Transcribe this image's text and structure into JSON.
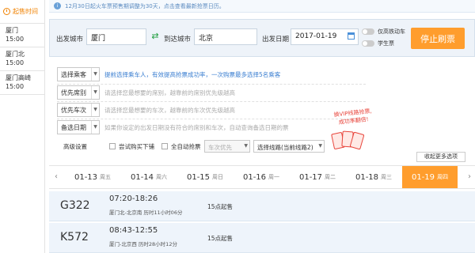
{
  "sidebar": {
    "header": "起售时间",
    "items": [
      {
        "station": "厦门",
        "time": "15:00"
      },
      {
        "station": "厦门北",
        "time": "15:00"
      },
      {
        "station": "厦门高崎",
        "time": "15:00"
      }
    ]
  },
  "notice": {
    "text": "12月30日起火车票预售期调整为30天，点击查看最新抢票日历。"
  },
  "search": {
    "from_label": "出发城市",
    "from_value": "厦门",
    "to_label": "到达城市",
    "to_value": "北京",
    "date_label": "出发日期",
    "date_value": "2017-01-19",
    "toggle_highspeed": "仅高铁动车",
    "toggle_student": "学生票",
    "stop_button": "停止刷票"
  },
  "options": {
    "passenger": {
      "label": "选择乘客",
      "hint": "提前选择乘车人，有效提高抢票成功率，一次购票最多选择5名乘客"
    },
    "priority_seat": {
      "label": "优先席别",
      "hint": "请选择您最想要的席别，越靠前的席别优先级越高"
    },
    "priority_train": {
      "label": "优先车次",
      "hint": "请选择您最想要的车次，越靠前的车次优先级越高"
    },
    "backup_date": {
      "label": "备选日期",
      "hint": "如果你设定的出发日期没有符合的席别和车次，自动查询备选日期的票"
    },
    "advanced_label": "高级设置",
    "try_supplement": "尝试购买下铺",
    "auto_grab": "全自动抢票",
    "train_priority_select": "车次优先",
    "route_select": "选择线路(当前线路2)",
    "more_button": "收起更多选项",
    "promo_line1": "换VIP线路抢票,",
    "promo_line2": "成功率翻倍!"
  },
  "date_tabs": [
    {
      "date": "01-13",
      "weekday": "周五"
    },
    {
      "date": "01-14",
      "weekday": "周六"
    },
    {
      "date": "01-15",
      "weekday": "周日"
    },
    {
      "date": "01-16",
      "weekday": "周一"
    },
    {
      "date": "01-17",
      "weekday": "周二"
    },
    {
      "date": "01-18",
      "weekday": "周三"
    },
    {
      "date": "01-19",
      "weekday": "周四"
    }
  ],
  "trains": [
    {
      "number": "G322",
      "time": "07:20-18:26",
      "stations": "厦门北-北京南 历时11小时06分",
      "sale": "15点起售"
    },
    {
      "number": "K572",
      "time": "08:43-12:55",
      "stations": "厦门-北京西 历时28小时12分",
      "sale": "15点起售"
    }
  ],
  "colors": {
    "accent": "#ff9d2d",
    "highlight_text": "#f08200",
    "row_bg": "#eef4fb"
  }
}
